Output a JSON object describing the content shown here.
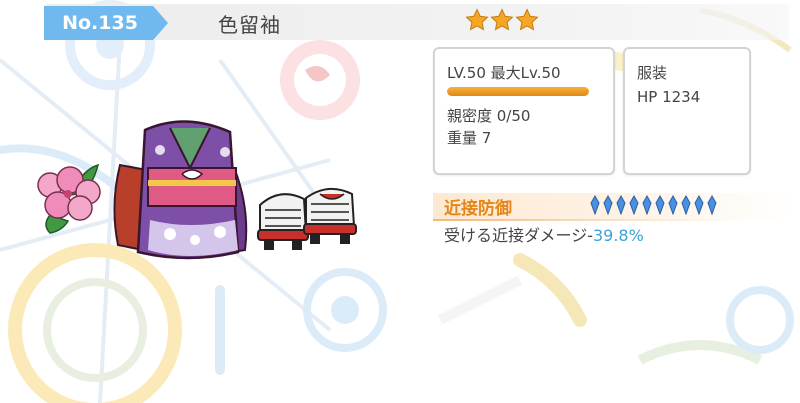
{
  "header": {
    "number": "No.135",
    "item_name": "色留袖",
    "rarity_stars": 3,
    "star_color": "#f5a623"
  },
  "stats_card": {
    "level_text": "LV.50 最大Lv.50",
    "level_progress": 1.0,
    "intimacy_text": "親密度 0/50",
    "weight_text": "重量 7"
  },
  "type_card": {
    "category": "服装",
    "hp_text": "HP 1234"
  },
  "skill": {
    "name": "近接防御",
    "pip_count": 10,
    "pip_color": "#4a8fe0",
    "effect_label": "受ける近接ダメージ-",
    "effect_value": "39.8%"
  },
  "colors": {
    "number_tag": "#6fb9ef",
    "skill_name": "#e68618",
    "effect_value": "#3aa3d8"
  }
}
